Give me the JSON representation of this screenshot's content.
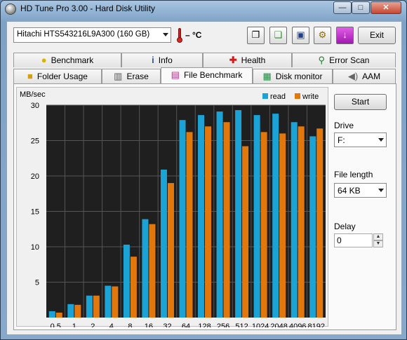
{
  "window": {
    "title": "HD Tune Pro 3.00 - Hard Disk Utility",
    "minimize": "—",
    "maximize": "□",
    "close": "✕"
  },
  "toolbar": {
    "drive": "Hitachi HTS543216L9A300 (160 GB)",
    "temperature": "– °C",
    "exit_label": "Exit",
    "icons": [
      "copy-info-icon",
      "copy-screenshot-icon",
      "save-icon",
      "options-icon",
      "download-icon"
    ]
  },
  "tabs_row1": [
    "Benchmark",
    "Info",
    "Health",
    "Error Scan"
  ],
  "tabs_row2": [
    "Folder Usage",
    "Erase",
    "File Benchmark",
    "Disk monitor",
    "AAM"
  ],
  "active_tab": "File Benchmark",
  "side": {
    "start_label": "Start",
    "drive_label": "Drive",
    "drive_value": "F:",
    "file_length_label": "File length",
    "file_length_value": "64 KB",
    "delay_label": "Delay",
    "delay_value": "0"
  },
  "colors": {
    "read": "#1ba3d6",
    "write": "#e2780c",
    "plot_bg": "#1f1f1f",
    "grid": "#555555"
  },
  "chart_data": {
    "type": "bar",
    "ylabel": "MB/sec",
    "ylim": [
      0,
      30
    ],
    "yticks": [
      5,
      10,
      15,
      20,
      25,
      30
    ],
    "categories": [
      "0.5",
      "1",
      "2",
      "4",
      "8",
      "16",
      "32",
      "64",
      "128",
      "256",
      "512",
      "1024",
      "2048",
      "4096",
      "8192"
    ],
    "series": [
      {
        "name": "read",
        "values": [
          0.9,
          1.9,
          3.1,
          4.5,
          10.3,
          13.9,
          20.9,
          27.9,
          28.6,
          29.1,
          29.3,
          28.6,
          28.8,
          27.6,
          25.6
        ]
      },
      {
        "name": "write",
        "values": [
          0.7,
          1.8,
          3.1,
          4.4,
          8.6,
          13.2,
          19.0,
          26.2,
          27.0,
          27.6,
          24.2,
          26.2,
          26.0,
          27.0,
          26.7
        ]
      }
    ],
    "legend_position": "top-right",
    "grid": true
  }
}
